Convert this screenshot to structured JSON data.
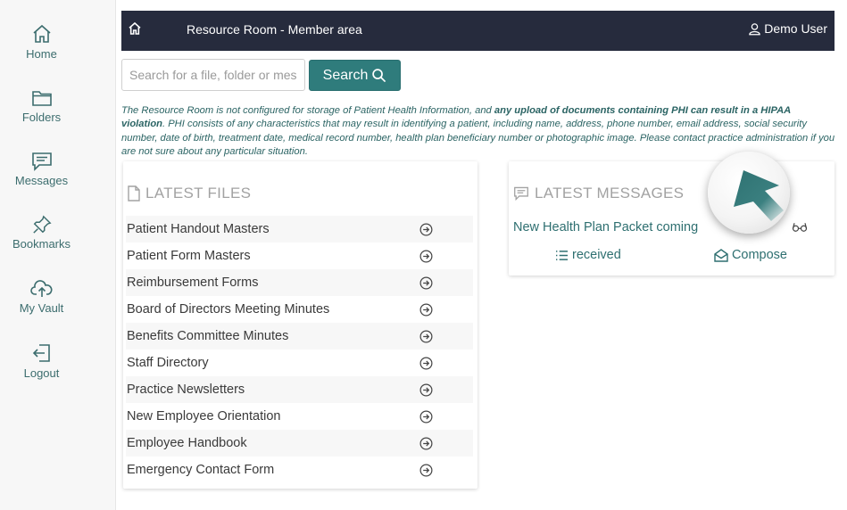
{
  "sidebar": {
    "items": [
      {
        "label": "Home",
        "icon": "home-icon"
      },
      {
        "label": "Folders",
        "icon": "folder-icon"
      },
      {
        "label": "Messages",
        "icon": "message-icon"
      },
      {
        "label": "Bookmarks",
        "icon": "pin-icon"
      },
      {
        "label": "My Vault",
        "icon": "cloud-upload-icon"
      },
      {
        "label": "Logout",
        "icon": "logout-icon"
      }
    ]
  },
  "topbar": {
    "title": "Resource Room - Member area",
    "user": "Demo User"
  },
  "search": {
    "placeholder": "Search for a file, folder or message",
    "button_label": "Search"
  },
  "notice": {
    "part1": "The Resource Room is not configured for storage of Patient Health Information, and ",
    "bold": "any upload of documents containing PHI can result in a HIPAA violation",
    "part2": ". PHI consists of any characteristics that may result in identifying a patient, including name, address, phone number, email address, social security number, date of birth, treatment date, medical record number, health plan beneficiary number or photographic image. Please contact practice administration if you are not sure about any particular situation."
  },
  "files": {
    "title": "LATEST FILES",
    "items": [
      "Patient Handout Masters",
      "Patient Form Masters",
      "Reimbursement Forms",
      "Board of Directors Meeting Minutes",
      "Benefits Committee Minutes",
      "Staff Directory",
      "Practice Newsletters",
      "New Employee Orientation",
      "Employee Handbook",
      "Emergency Contact Form"
    ]
  },
  "messages": {
    "title": "LATEST MESSAGES",
    "latest": "New Health Plan Packet coming",
    "received_label": "received",
    "compose_label": "Compose"
  },
  "colors": {
    "accent": "#2f7c7c",
    "topbar": "#262b3d",
    "link": "#2e6f70"
  }
}
